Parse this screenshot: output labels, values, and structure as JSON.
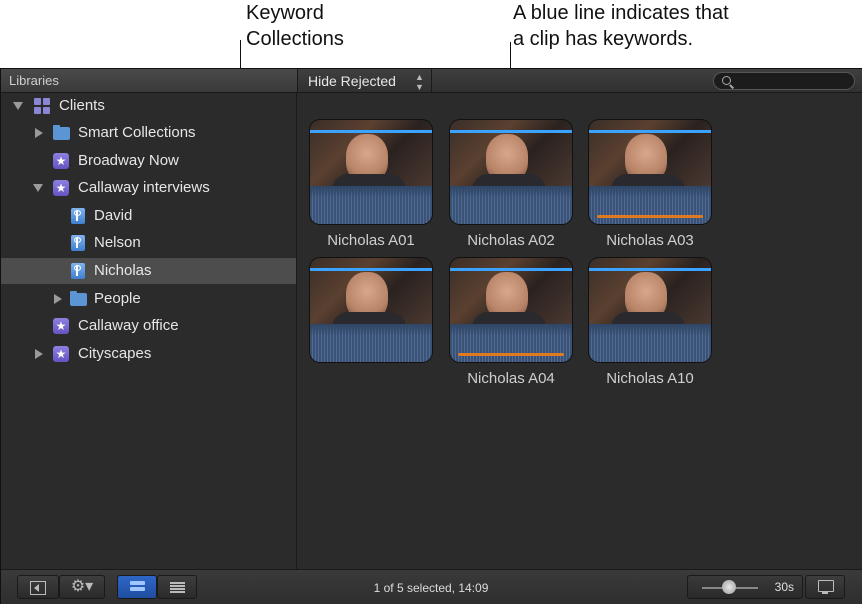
{
  "callouts": {
    "keyword_collections": [
      "Keyword",
      "Collections"
    ],
    "blue_line": [
      "A blue line indicates that",
      "a clip has keywords."
    ]
  },
  "header": {
    "libraries_label": "Libraries",
    "filter_label": "Hide Rejected"
  },
  "sidebar": {
    "items": [
      {
        "label": "Clients",
        "icon": "library-icon",
        "disclosure": "expanded",
        "level": 0
      },
      {
        "label": "Smart Collections",
        "icon": "folder-icon",
        "disclosure": "collapsed",
        "level": 1
      },
      {
        "label": "Broadway Now",
        "icon": "event-icon",
        "disclosure": "none",
        "level": 1
      },
      {
        "label": "Callaway interviews",
        "icon": "event-icon",
        "disclosure": "expanded",
        "level": 1
      },
      {
        "label": "David",
        "icon": "keyword-collection-icon",
        "disclosure": "none",
        "level": 2
      },
      {
        "label": "Nelson",
        "icon": "keyword-collection-icon",
        "disclosure": "none",
        "level": 2
      },
      {
        "label": "Nicholas",
        "icon": "keyword-collection-icon",
        "disclosure": "none",
        "level": 2,
        "selected": true
      },
      {
        "label": "People",
        "icon": "folder-icon",
        "disclosure": "collapsed",
        "level": 2
      },
      {
        "label": "Callaway office",
        "icon": "event-icon",
        "disclosure": "none",
        "level": 1
      },
      {
        "label": "Cityscapes",
        "icon": "event-icon",
        "disclosure": "collapsed",
        "level": 1
      }
    ]
  },
  "clips": [
    {
      "name": "Nicholas A01",
      "keywords": true,
      "rejected_range": false
    },
    {
      "name": "Nicholas A02",
      "keywords": true,
      "rejected_range": false
    },
    {
      "name": "Nicholas A03",
      "keywords": true,
      "rejected_range": true
    },
    {
      "name": "",
      "keywords": true,
      "rejected_range": false
    },
    {
      "name": "Nicholas A04",
      "keywords": true,
      "rejected_range": true
    },
    {
      "name": "Nicholas A10",
      "keywords": true,
      "rejected_range": false
    }
  ],
  "status": "1 of 5 selected, 14:09",
  "zoom": {
    "duration_label": "30s",
    "level": 0.45
  },
  "colors": {
    "keyword_line": "#3aa3ff",
    "rejected_line": "#e07a20",
    "selection": "#4d4d4d"
  }
}
